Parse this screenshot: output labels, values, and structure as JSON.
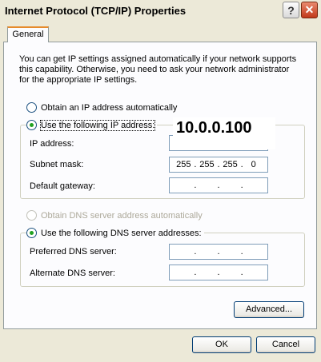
{
  "window": {
    "title": "Internet Protocol (TCP/IP) Properties",
    "help_glyph": "?",
    "close_glyph": "✕"
  },
  "tabs": [
    {
      "label": "General",
      "selected": true
    }
  ],
  "intro_text": "You can get IP settings assigned automatically if your network supports this capability. Otherwise, you need to ask your network administrator for the appropriate IP settings.",
  "ip_section": {
    "auto_label": "Obtain an IP address automatically",
    "auto_selected": false,
    "manual_label": "Use the following IP address:",
    "manual_selected": true,
    "overlay_text": "10.0.0.100",
    "fields": [
      {
        "label": "IP address:",
        "octets": [
          "",
          "",
          "",
          ""
        ]
      },
      {
        "label": "Subnet mask:",
        "octets": [
          "255",
          "255",
          "255",
          "0"
        ]
      },
      {
        "label": "Default gateway:",
        "octets": [
          "",
          "",
          "",
          ""
        ]
      }
    ]
  },
  "dns_section": {
    "auto_label": "Obtain DNS server address automatically",
    "auto_enabled": false,
    "manual_label": "Use the following DNS server addresses:",
    "manual_selected": true,
    "fields": [
      {
        "label": "Preferred DNS server:",
        "octets": [
          "",
          "",
          "",
          ""
        ]
      },
      {
        "label": "Alternate DNS server:",
        "octets": [
          "",
          "",
          "",
          ""
        ]
      }
    ]
  },
  "buttons": {
    "advanced": "Advanced...",
    "ok": "OK",
    "cancel": "Cancel"
  }
}
